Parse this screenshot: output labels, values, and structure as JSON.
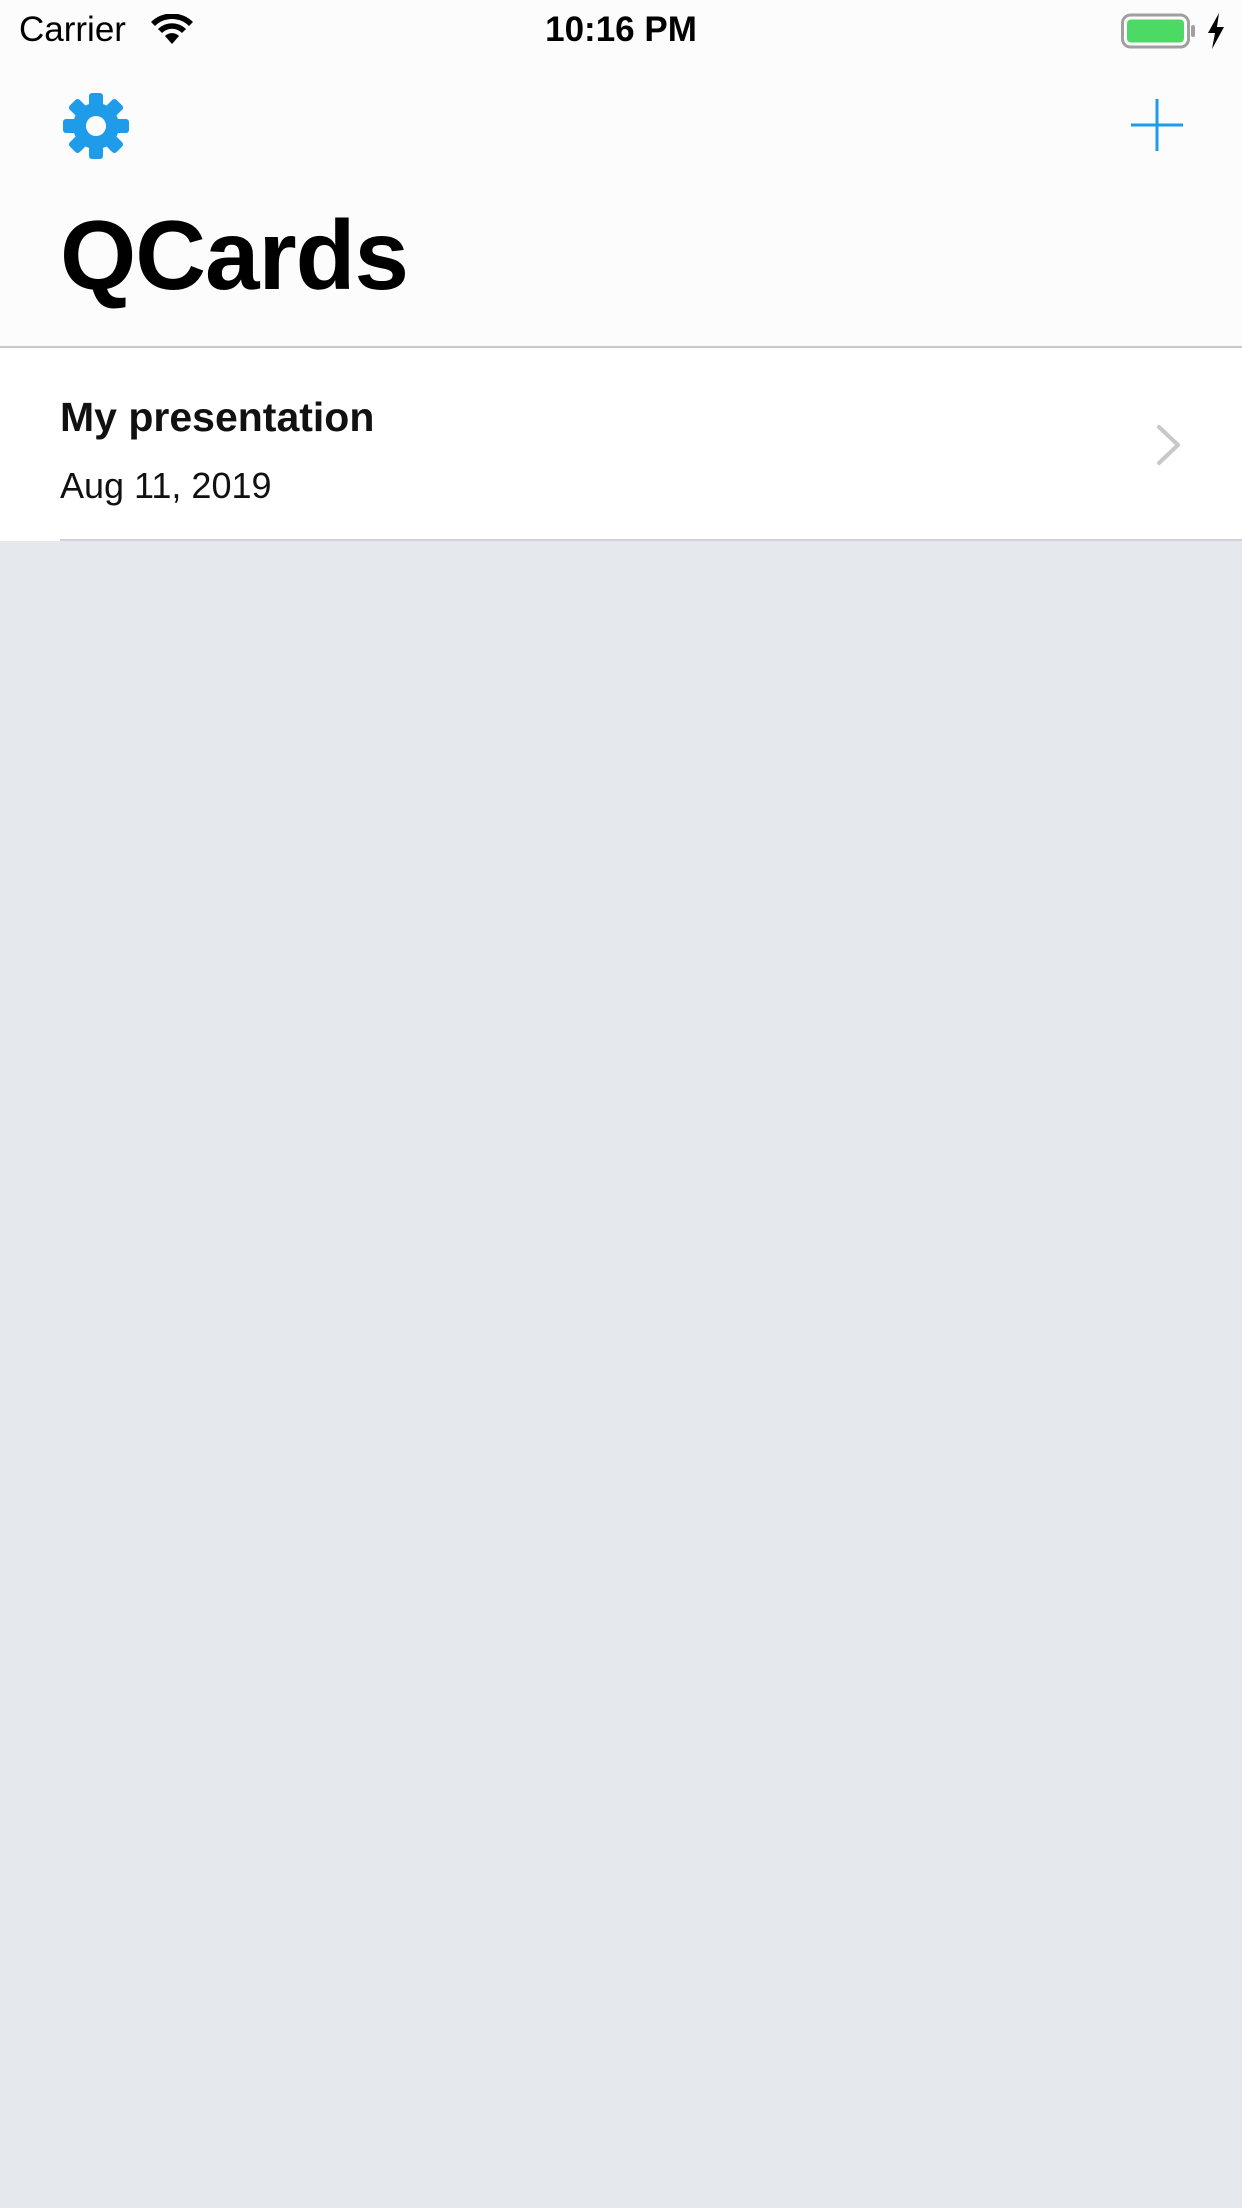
{
  "status_bar": {
    "carrier": "Carrier",
    "time": "10:16 PM",
    "wifi_icon": "wifi-icon",
    "battery_icon": "battery-icon",
    "charging_icon": "bolt-icon",
    "battery_color": "#4cd964"
  },
  "nav": {
    "title": "QCards",
    "left_icon": "gear-icon",
    "right_icon": "plus-icon",
    "accent_color": "#1e9be9"
  },
  "presentations": [
    {
      "title": "My presentation",
      "date": "Aug 11, 2019",
      "icon": "chevron-right-icon"
    }
  ]
}
